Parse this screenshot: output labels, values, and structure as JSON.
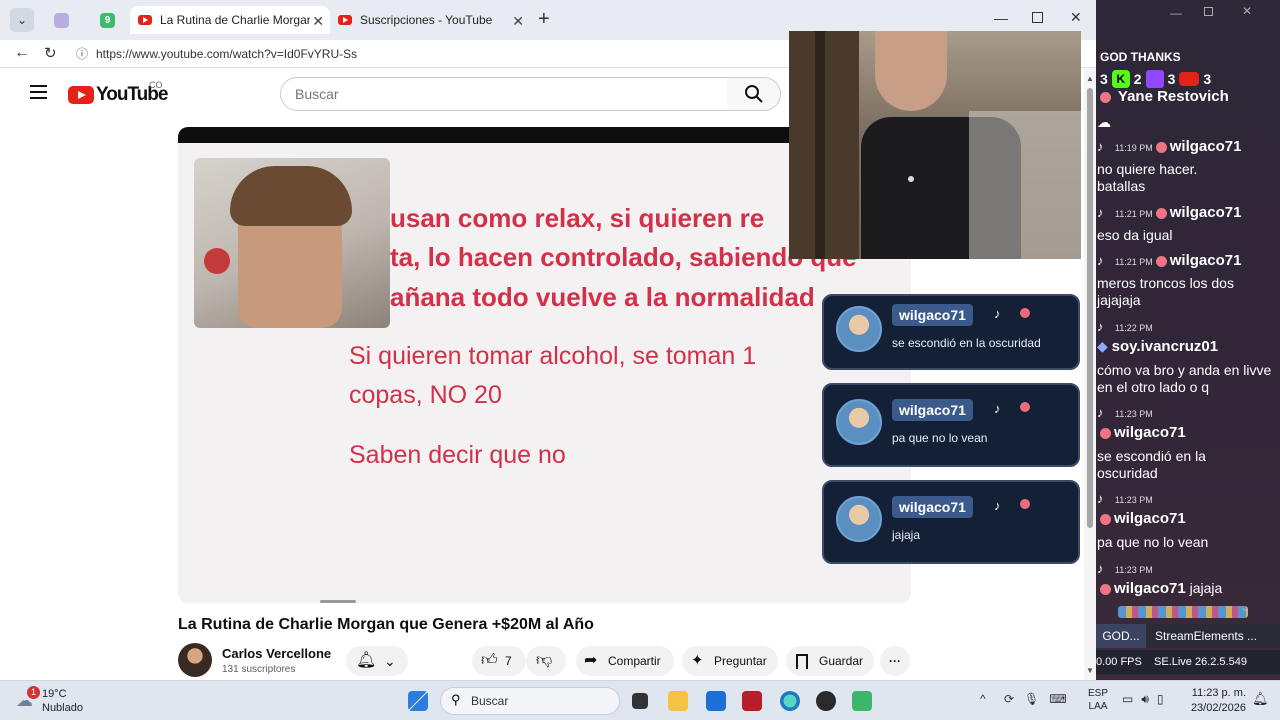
{
  "browser": {
    "tabs": [
      {
        "label": "La Rutina de Charlie Morgan que G"
      },
      {
        "label": "Suscripciones - YouTube"
      }
    ],
    "badge_count": "9",
    "url": "https://www.youtube.com/watch?v=Id0FvYRU-Ss"
  },
  "youtube": {
    "logo_text": "YouTube",
    "country_code": "CO",
    "search_placeholder": "Buscar"
  },
  "video": {
    "slide_lines_bold": [
      "usan como relax, si quieren re",
      "ta, lo hacen controlado, sabiendo que",
      "añana todo vuelve a la normalidad"
    ],
    "slide_lines": [
      "Si quieren tomar alcohol, se toman 1",
      "copas, NO 20",
      "Saben decir que no"
    ],
    "title": "La Rutina de Charlie Morgan que Genera +$20M al Año",
    "channel": "Carlos Vercellone",
    "subscribers": "131 suscriptores",
    "likes": "7",
    "actions": {
      "share": "Compartir",
      "ask": "Preguntar",
      "save": "Guardar"
    }
  },
  "overlay_chat": [
    {
      "user": "wilgaco71",
      "msg": "se escondió en la oscuridad"
    },
    {
      "user": "wilgaco71",
      "msg": "pa que no lo vean"
    },
    {
      "user": "wilgaco71",
      "msg": "jajaja"
    }
  ],
  "side_panel": {
    "header": "GOD THANKS",
    "counts": [
      "3",
      "2",
      "3",
      "3"
    ],
    "top_user": "Yane Restovich",
    "messages": [
      {
        "time": "11:19 PM",
        "user": "wilgaco71",
        "text": "no quiere hacer. batallas"
      },
      {
        "time": "11:21 PM",
        "user": "wilgaco71",
        "text": "eso da igual"
      },
      {
        "time": "11:21 PM",
        "user": "wilgaco71",
        "text": "meros troncos los dos jajajaja"
      },
      {
        "time": "11:22 PM",
        "user": "soy.ivancruz01",
        "text": "cómo va bro y anda en livve en el otro lado o q"
      },
      {
        "time": "11:23 PM",
        "user": "wilgaco71",
        "text": "se escondió en la oscuridad"
      },
      {
        "time": "11:23 PM",
        "user": "wilgaco71",
        "text": "pa que no lo vean"
      },
      {
        "time": "11:23 PM",
        "user": "wilgaco71",
        "text": "jajaja"
      }
    ],
    "tabs": [
      "GOD...",
      "StreamElements ..."
    ],
    "fps": "0.00 FPS",
    "version": "SE.Live 26.2.5.549"
  },
  "taskbar": {
    "temp": "19°C",
    "weather": "Nublado",
    "weather_badge": "1",
    "search": "Buscar",
    "lang": "ESP",
    "region": "LAA",
    "time": "11:23 p. m.",
    "date": "23/02/2026"
  },
  "colors": {
    "youtube_red": "#e62117",
    "slide_red": "#d3304a",
    "chat_card": "#142036"
  }
}
